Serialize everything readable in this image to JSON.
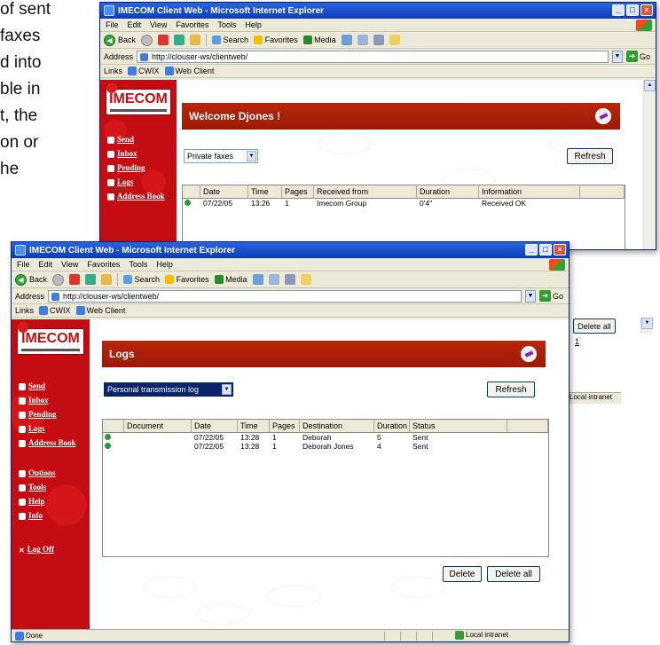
{
  "doc_lines": [
    "of sent",
    " faxes",
    "d into",
    "ble in",
    "t, the",
    "on or",
    "he"
  ],
  "win_back": {
    "title": "IMECOM Client Web - Microsoft Internet Explorer",
    "menu": [
      "File",
      "Edit",
      "View",
      "Favorites",
      "Tools",
      "Help"
    ],
    "toolbar": {
      "back": "Back",
      "search": "Search",
      "favorites": "Favorites",
      "media": "Media"
    },
    "address_label": "Address",
    "address_value": "http://clouser-ws/clientweb/",
    "go_label": "Go",
    "links_label": "Links",
    "links": [
      "CWIX",
      "Web Client"
    ],
    "banner_title": "Welcome Djones !",
    "select_value": "Private faxes",
    "refresh_label": "Refresh",
    "columns": [
      "Date",
      "Time",
      "Pages",
      "Received from",
      "Duration",
      "Information"
    ],
    "rows": [
      {
        "date": "07/22/05",
        "time": "13:26",
        "pages": "1",
        "from": "Imecom Group",
        "duration": "0'4\"",
        "info": "Received OK"
      }
    ],
    "peek_button": "Delete all",
    "peek_text": "1",
    "status_right": "Local intranet"
  },
  "win_front": {
    "title": "IMECOM Client Web - Microsoft Internet Explorer",
    "menu": [
      "File",
      "Edit",
      "View",
      "Favorites",
      "Tools",
      "Help"
    ],
    "toolbar": {
      "back": "Back",
      "search": "Search",
      "favorites": "Favorites",
      "media": "Media"
    },
    "address_label": "Address",
    "address_value": "http://clouser-ws/clientweb/",
    "go_label": "Go",
    "links_label": "Links",
    "links": [
      "CWIX",
      "Web Client"
    ],
    "banner_title": "Logs",
    "select_value": "Personal transmission log",
    "refresh_label": "Refresh",
    "columns": [
      "Document",
      "Date",
      "Time",
      "Pages",
      "Destination",
      "Duration",
      "Status"
    ],
    "rows": [
      {
        "document": "",
        "date": "07/22/05",
        "time": "13:28",
        "pages": "1",
        "destination": "Deborah",
        "duration": "5",
        "status": "Sent"
      },
      {
        "document": "",
        "date": "07/22/05",
        "time": "13:28",
        "pages": "1",
        "destination": "Deborah Jones",
        "duration": "4",
        "status": "Sent"
      }
    ],
    "delete_label": "Delete",
    "delete_all_label": "Delete all",
    "status_left": "Done",
    "status_right": "Local intranet"
  },
  "logo_text": "IMECOM",
  "nav": {
    "back_items": [
      "Send",
      "Inbox",
      "Pending",
      "Logs",
      "Address Book"
    ],
    "front_items": [
      "Send",
      "Inbox",
      "Pending",
      "Logs",
      "Address Book",
      "Options",
      "Tools",
      "Help",
      "Info",
      "Log Off"
    ]
  },
  "icons": {
    "back": "back-arrow-icon",
    "forward": "forward-arrow-icon",
    "search": "search-icon",
    "favorites": "star-icon",
    "media": "media-icon",
    "go": "go-arrow-icon",
    "banner": "envelope-icon"
  },
  "colors": {
    "sidebar": "#c30d12",
    "banner": "#a91e08",
    "titlebar": "#0a3cb8",
    "status_dot": "#2a9a2f"
  }
}
